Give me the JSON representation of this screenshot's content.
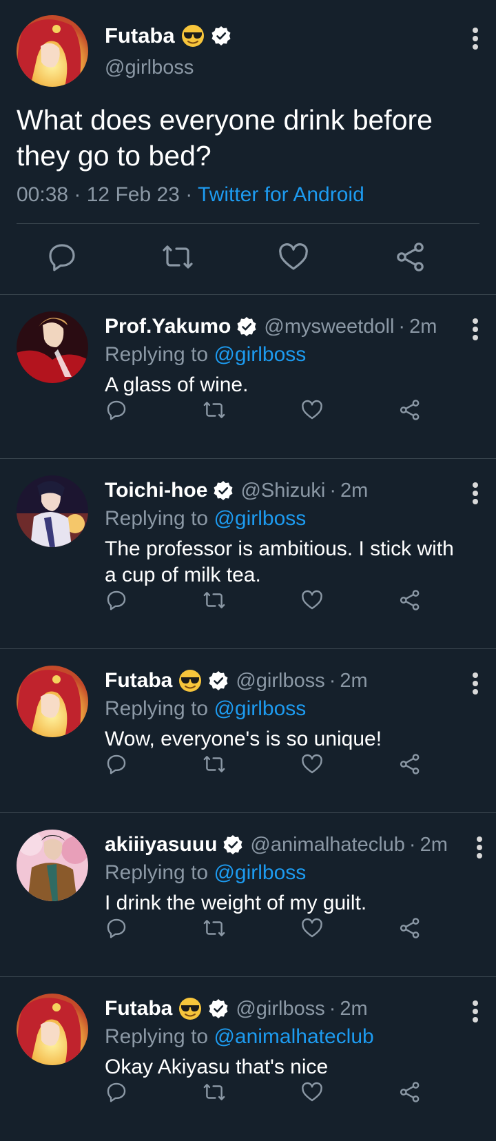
{
  "main_tweet": {
    "author_name": "Futaba",
    "author_emoji": "smiling-face-with-sunglasses",
    "author_handle": "@girlboss",
    "text": "What does everyone drink before they go to bed?",
    "time": "00:38",
    "date": "12 Feb 23",
    "source": "Twitter for Android",
    "meta_sep": " · ",
    "actions": [
      "reply-icon",
      "retweet-icon",
      "like-icon",
      "share-icon"
    ]
  },
  "replies": [
    {
      "author_name": "Prof.Yakumo",
      "author_handle": "@mysweetdoll",
      "sep": "·",
      "time": "2m",
      "replying_label": "Replying to ",
      "replying_to": "@girlboss",
      "text": "A glass of wine."
    },
    {
      "author_name": "Toichi-hoe",
      "author_handle": "@Shizuki",
      "sep": "·",
      "time": "2m",
      "replying_label": "Replying to ",
      "replying_to": "@girlboss",
      "text": "The professor is ambitious. I stick with a cup of milk tea."
    },
    {
      "author_name": "Futaba",
      "author_emoji": "smiling-face-with-sunglasses",
      "author_handle": "@girlboss",
      "sep": "·",
      "time": "2m",
      "replying_label": "Replying to ",
      "replying_to": "@girlboss",
      "text": "Wow, everyone's is so unique!"
    },
    {
      "author_name": "akiiiyasuuu",
      "author_handle": "@animalhateclub",
      "sep": "·",
      "time": "2m",
      "replying_label": "Replying to ",
      "replying_to": "@girlboss",
      "text": "I drink the weight of my guilt."
    },
    {
      "author_name": "Futaba",
      "author_emoji": "smiling-face-with-sunglasses",
      "author_handle": "@girlboss",
      "sep": "·",
      "time": "2m",
      "replying_label": "Replying to ",
      "replying_to": "@animalhateclub",
      "text": "Okay Akiyasu that's nice"
    }
  ],
  "colors": {
    "background": "#15202b",
    "divider": "#38444d",
    "secondary_text": "#8b98a5",
    "link": "#1d9bf0",
    "icon": "#8b98a5"
  }
}
